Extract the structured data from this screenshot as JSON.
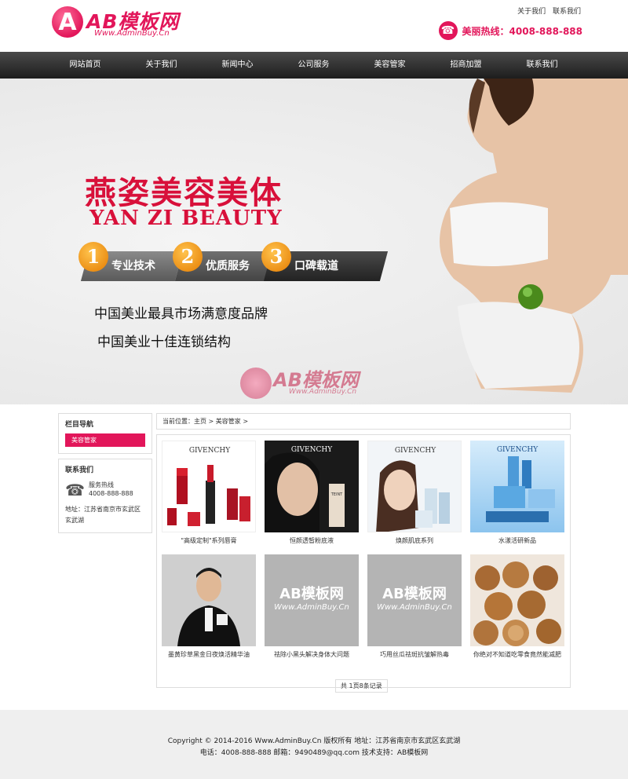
{
  "header": {
    "logo_text": "AB模板网",
    "logo_url": "Www.AdminBuy.Cn",
    "toplinks": [
      "关于我们",
      "联系我们"
    ],
    "hotline": "美丽热线：4008-888-888"
  },
  "nav": [
    "网站首页",
    "关于我们",
    "新闻中心",
    "公司服务",
    "美容管家",
    "招商加盟",
    "联系我们"
  ],
  "banner": {
    "brand_cn": "燕姿美容美体",
    "brand_en": "YAN ZI BEAUTY",
    "features": [
      {
        "num": "1",
        "label": "专业技术"
      },
      {
        "num": "2",
        "label": "优质服务"
      },
      {
        "num": "3",
        "label": "口碑载道"
      }
    ],
    "slogan1": "中国美业最具市场满意度品牌",
    "slogan2": "中国美业十佳连锁结构",
    "watermark_text": "AB模板网",
    "watermark_url": "Www.AdminBuy.Cn"
  },
  "sidebar": {
    "nav_title": "栏目导航",
    "active_item": "美容管家",
    "contact_title": "联系我们",
    "hotline_label": "服务热线",
    "hotline_number": "4008-888-888",
    "address": "地址：江苏省南京市玄武区玄武湖"
  },
  "breadcrumb": "当前位置：主页 > 美容管家 >",
  "products": [
    {
      "caption": "\"高级定制\"系列唇膏",
      "brand": "GIVENCHY",
      "kind": "lipstick"
    },
    {
      "caption": "恒颜透皙粉底液",
      "brand": "GIVENCHY",
      "kind": "face"
    },
    {
      "caption": "焕颜肌底系列",
      "brand": "GIVENCHY",
      "kind": "face2"
    },
    {
      "caption": "水漾活研新品",
      "brand": "GIVENCHY",
      "kind": "blue"
    },
    {
      "caption": "墨黄珍草黑金日夜焕活精华油",
      "brand": "",
      "kind": "man"
    },
    {
      "caption": "祛除小黑头解决身体大问题",
      "brand": "AB模板网",
      "kind": "placeholder",
      "url": "Www.AdminBuy.Cn"
    },
    {
      "caption": "巧用丝瓜祛斑抗皱解热毒",
      "brand": "AB模板网",
      "kind": "placeholder",
      "url": "Www.AdminBuy.Cn"
    },
    {
      "caption": "你绝对不知道吃零食竟然能减肥",
      "brand": "",
      "kind": "walnut"
    }
  ],
  "pager": "共 1页8条记录",
  "footer": {
    "line1": "Copyright © 2014-2016 Www.AdminBuy.Cn 版权所有    地址：江苏省南京市玄武区玄武湖",
    "line2": "电话：4008-888-888       邮箱：9490489@qq.com       技术支持：AB模板网"
  },
  "colors": {
    "accent": "#e2165a",
    "nav_bg": "#2a2a2a",
    "feature_orange": "#f0a020"
  }
}
